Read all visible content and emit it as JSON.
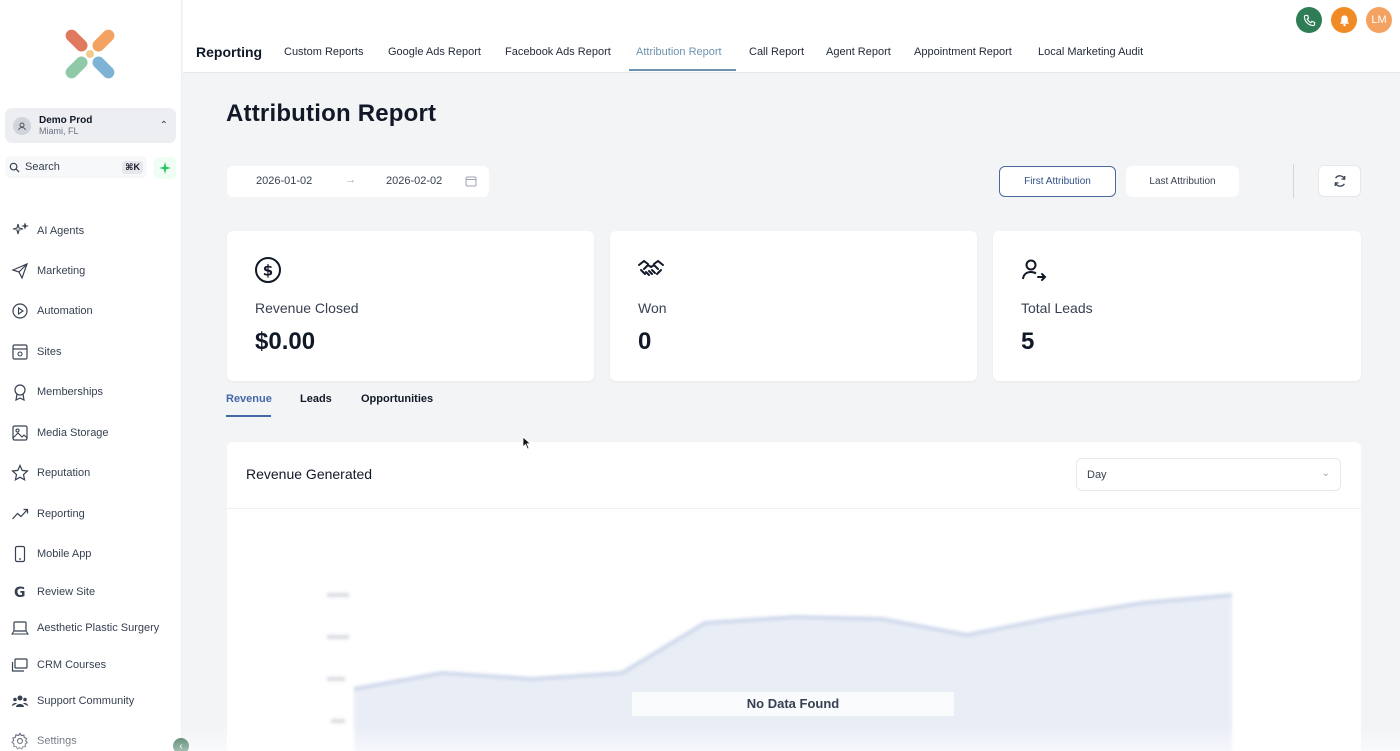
{
  "account": {
    "name": "Demo Prod",
    "location": "Miami, FL"
  },
  "search": {
    "label": "Search",
    "shortcut": "⌘K"
  },
  "sidebar": {
    "items": [
      {
        "label": "AI Agents",
        "icon": "sparkles-icon"
      },
      {
        "label": "Marketing",
        "icon": "send-icon"
      },
      {
        "label": "Automation",
        "icon": "play-circle-icon"
      },
      {
        "label": "Sites",
        "icon": "browser-icon"
      },
      {
        "label": "Memberships",
        "icon": "award-icon"
      },
      {
        "label": "Media Storage",
        "icon": "image-icon"
      },
      {
        "label": "Reputation",
        "icon": "star-icon"
      },
      {
        "label": "Reporting",
        "icon": "trend-icon"
      },
      {
        "label": "Mobile App",
        "icon": "mobile-icon"
      },
      {
        "label": "Review Site",
        "icon": "google-icon"
      },
      {
        "label": "Aesthetic Plastic Surgery",
        "icon": "laptop-icon"
      },
      {
        "label": "CRM Courses",
        "icon": "courses-icon"
      },
      {
        "label": "Support Community",
        "icon": "users-icon"
      },
      {
        "label": "Settings",
        "icon": "gear-icon"
      }
    ]
  },
  "topbar": {
    "title": "Reporting",
    "tabs": [
      "Custom Reports",
      "Google Ads Report",
      "Facebook Ads Report",
      "Attribution Report",
      "Call Report",
      "Agent Report",
      "Appointment Report",
      "Local Marketing Audit"
    ],
    "active_tab": "Attribution Report",
    "user_initials": "LM"
  },
  "page": {
    "title": "Attribution Report",
    "date_start": "2026-01-02",
    "date_end": "2026-02-02",
    "first_attribution": "First Attribution",
    "last_attribution": "Last Attribution"
  },
  "cards": [
    {
      "label": "Revenue Closed",
      "value": "$0.00",
      "icon": "dollar-circle-icon"
    },
    {
      "label": "Won",
      "value": "0",
      "icon": "handshake-icon"
    },
    {
      "label": "Total Leads",
      "value": "5",
      "icon": "user-arrow-icon"
    }
  ],
  "subtabs": [
    "Revenue",
    "Leads",
    "Opportunities"
  ],
  "chart": {
    "title": "Revenue Generated",
    "interval": "Day",
    "empty_message": "No Data Found"
  },
  "colors": {
    "accent": "#4468a8",
    "tab_active": "#6b93b0",
    "phone": "#2f7d57",
    "bell": "#f08a24",
    "avatar": "#f4a261"
  }
}
